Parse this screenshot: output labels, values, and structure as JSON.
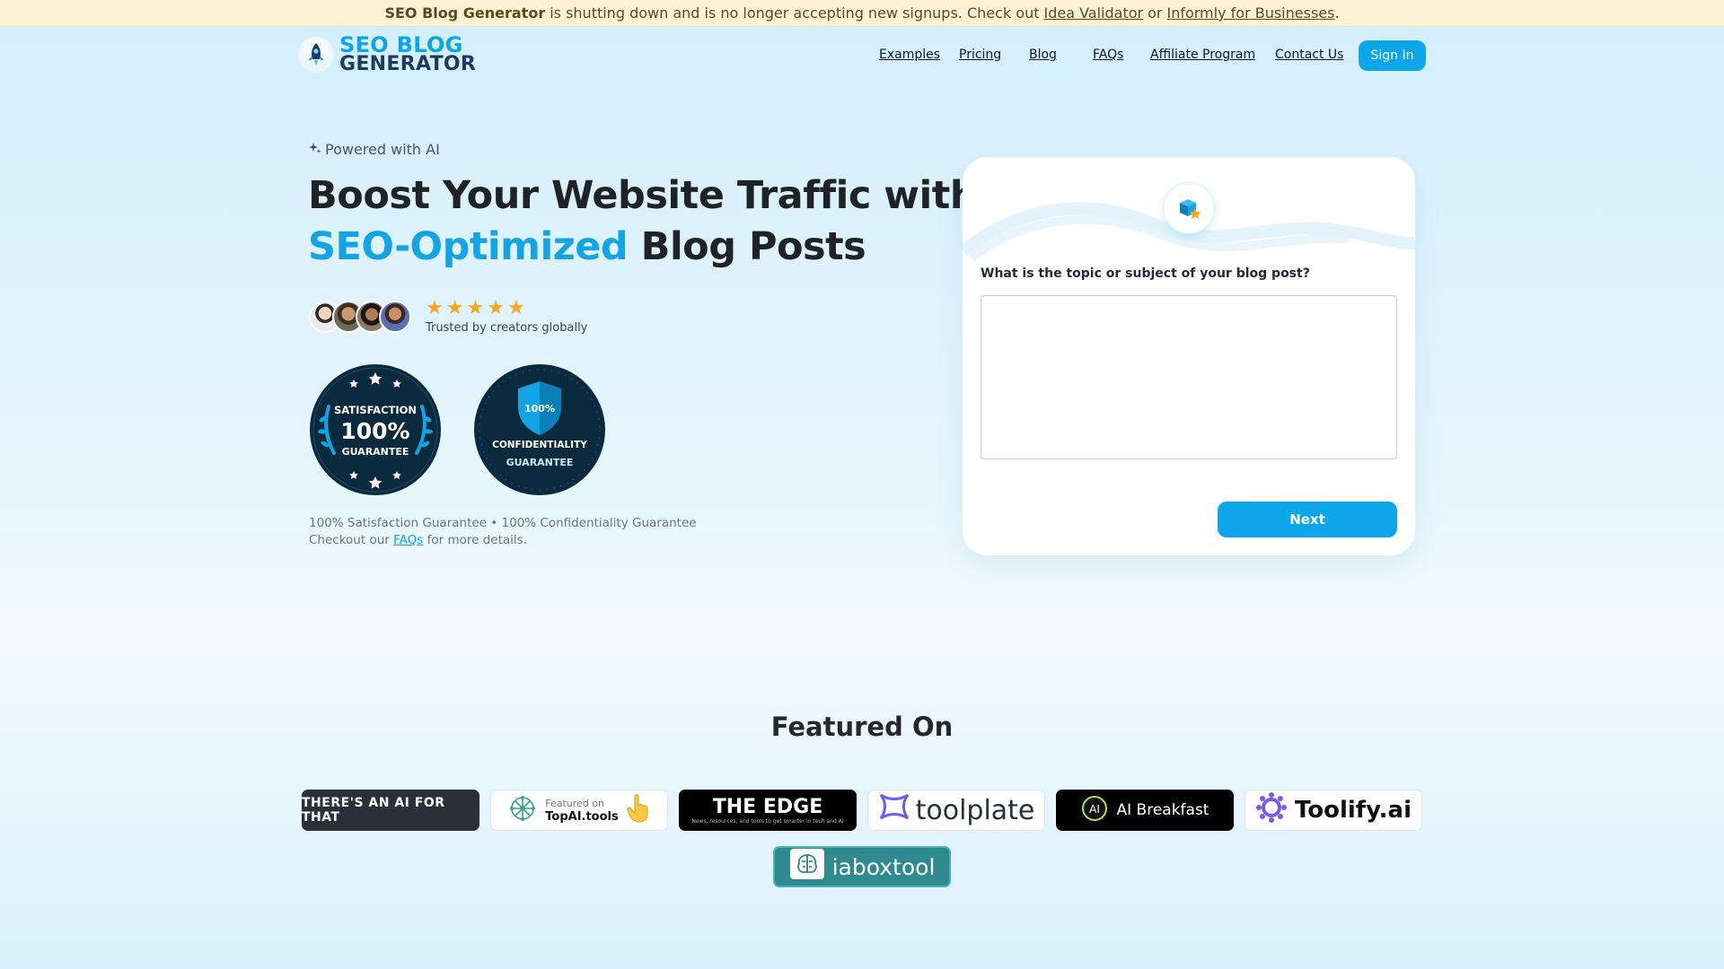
{
  "announcement": {
    "brand": "SEO Blog Generator",
    "message": "is shutting down and is no longer accepting new signups. Check out",
    "link1": "Idea Validator",
    "connector": "or",
    "link2": "Informly for Businesses",
    "end": "."
  },
  "header": {
    "logo_line1": "SEO BLOG",
    "logo_line2": "GENERATOR",
    "nav": [
      "Examples",
      "Pricing",
      "Blog",
      "FAQs",
      "Affiliate Program",
      "Contact Us"
    ],
    "signin_label": "Sign In"
  },
  "hero": {
    "powered": "Powered with AI",
    "headline_part1": "Boost Your Website Traffic with",
    "headline_accent": "SEO-Optimized",
    "headline_part2": "Blog Posts",
    "rating_stars": 5,
    "trusted_text": "Trusted by creators globally",
    "badge_satisfaction": {
      "top": "SATISFACTION",
      "big": "100%",
      "bottom": "GUARANTEE"
    },
    "badge_confidentiality": {
      "shield": "100%",
      "top": "CONFIDENTIALITY",
      "bottom": "GUARANTEE"
    },
    "guarantee_line": "100% Satisfaction Guarantee • 100% Confidentiality Guarantee",
    "details_prefix": "Checkout our",
    "details_link": "FAQs",
    "details_suffix": "for more details."
  },
  "form": {
    "question": "What is the topic or subject of your blog post?",
    "textarea_value": "",
    "next_label": "Next"
  },
  "featured": {
    "title": "Featured On",
    "items": {
      "aiforthat": "THERE'S AN AI FOR THAT",
      "topai_small": "Featured on",
      "topai_big": "TopAI.tools",
      "edge_big": "THE EDGE",
      "edge_small": "News, resources, and tools to get smarter in tech and AI",
      "toolplate": "toolplate",
      "breakfast": "AI Breakfast",
      "breakfast_mark": "AI",
      "toolify": "Toolify.ai",
      "iabox": "iaboxtool"
    }
  },
  "colors": {
    "accent": "#0ea5e9",
    "heading": "#1f2326",
    "star": "#f5a623",
    "badge_navy": "#0b2a3d",
    "announce_bg": "#fdf2d6"
  }
}
